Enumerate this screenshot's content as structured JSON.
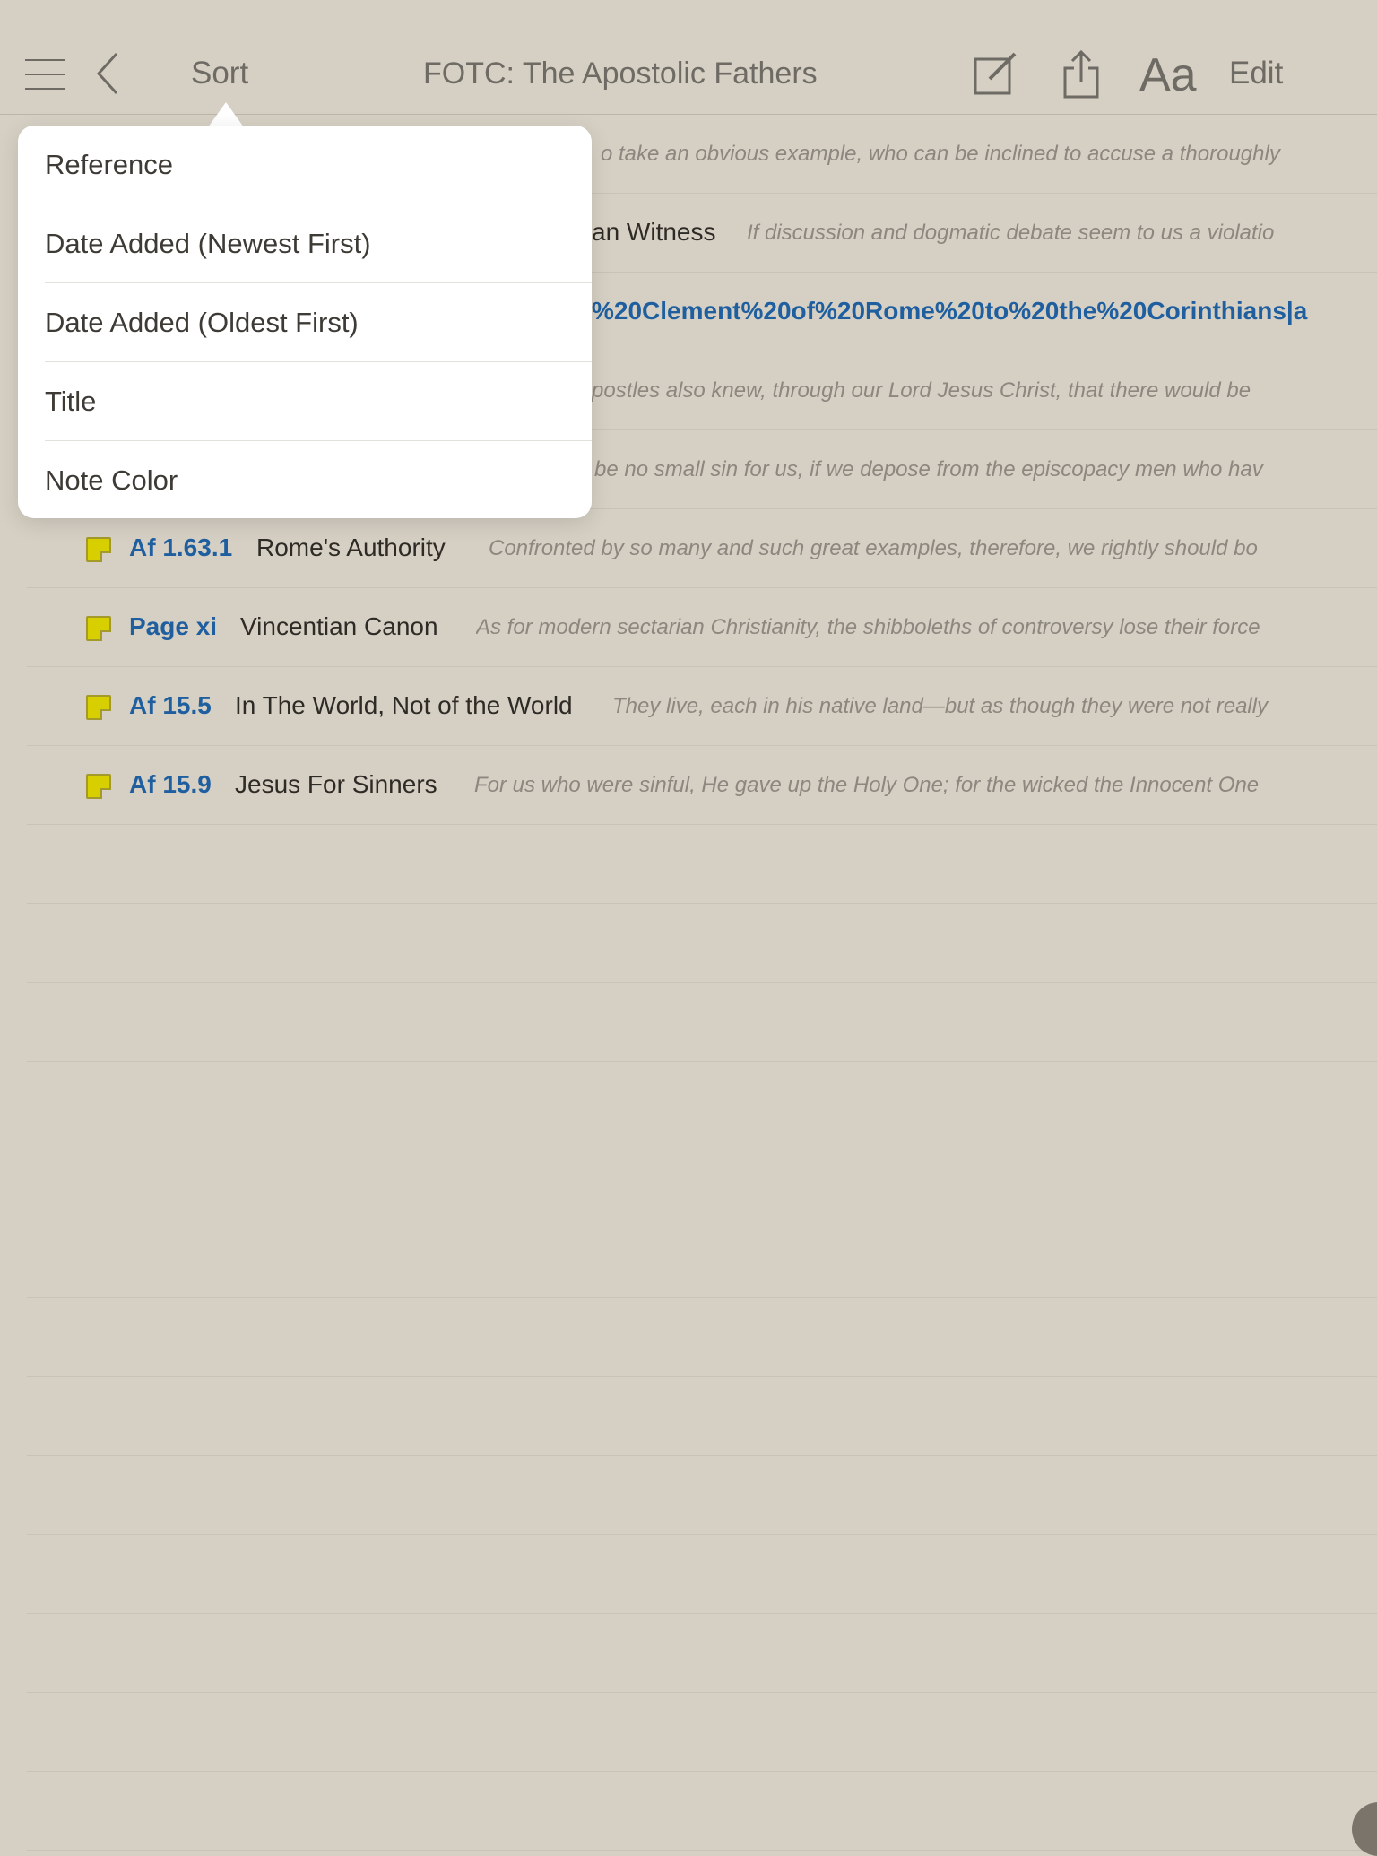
{
  "toolbar": {
    "sort_label": "Sort",
    "title": "FOTC: The Apostolic Fathers",
    "font_label": "Aa",
    "edit_label": "Edit"
  },
  "notes": [
    {
      "ref": "",
      "title": "",
      "excerpt": "o take an obvious example, who can be inclined to accuse a thoroughly"
    },
    {
      "ref": "",
      "title": "an Witness",
      "excerpt": "If discussion and dogmatic debate seem to us a violatio"
    },
    {
      "ref": "",
      "title": "",
      "link": "%20Clement%20of%20Rome%20to%20the%20Corinthians|a",
      "excerpt": ""
    },
    {
      "ref": "",
      "title": "",
      "excerpt": "postles also knew, through our Lord Jesus Christ, that there would be"
    },
    {
      "ref": "",
      "title": "",
      "excerpt": "be no small sin for us, if we depose from the episcopacy men who hav"
    },
    {
      "ref": "Af 1.63.1",
      "title": "Rome's Authority",
      "excerpt": "Confronted by so many and such great examples, therefore, we rightly should bo"
    },
    {
      "ref": "Page xi",
      "title": "Vincentian Canon",
      "excerpt": "As for modern sectarian Christianity, the shibboleths of controversy lose their force"
    },
    {
      "ref": "Af 15.5",
      "title": "In The World, Not of the World",
      "excerpt": "They live, each in his native land—but as though they were not really"
    },
    {
      "ref": "Af 15.9",
      "title": "Jesus For Sinners",
      "excerpt": "For us who were sinful, He gave up the Holy One; for the wicked the Innocent One"
    }
  ],
  "sort_menu": {
    "items": [
      "Reference",
      "Date Added (Newest First)",
      "Date Added (Oldest First)",
      "Title",
      "Note Color"
    ]
  },
  "colors": {
    "background": "#d6d0c4",
    "reference_blue": "#1f5f9f",
    "note_yellow": "#d8cf00"
  }
}
